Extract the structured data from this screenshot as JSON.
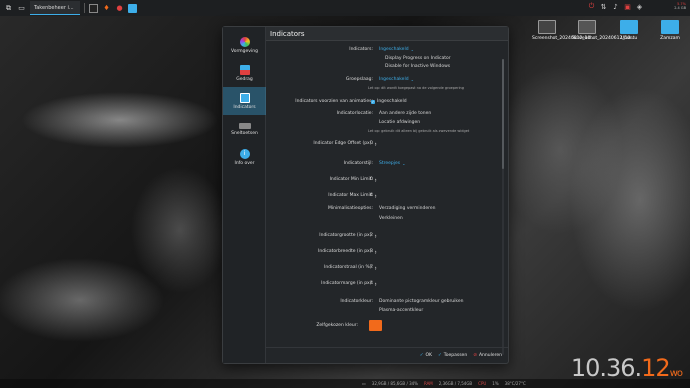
{
  "panel": {
    "task_label": "Takenbeheer i...",
    "memory": "5.7%",
    "disk": "2.4 GB"
  },
  "desktop": {
    "icons": [
      {
        "label": "Screenshot_20240612_10...",
        "color": "#555"
      },
      {
        "label": "Screenshot_20240612_10...",
        "color": "#666"
      },
      {
        "label": "Ubuntu",
        "color": "#3daee9"
      },
      {
        "label": "Zamzam",
        "color": "#3daee9"
      }
    ]
  },
  "window": {
    "title": "Indicators",
    "sidebar": [
      {
        "label": "Vormgeving",
        "icon": "palette-icon",
        "color": "#e04040"
      },
      {
        "label": "Gedrag",
        "icon": "behavior-icon",
        "color": "#3daee9"
      },
      {
        "label": "Indicators",
        "icon": "indicators-icon",
        "color": "#3daee9"
      },
      {
        "label": "Sneltoetsen",
        "icon": "keyboard-icon",
        "color": "#aaa"
      },
      {
        "label": "Info over",
        "icon": "info-icon",
        "color": "#3daee9"
      }
    ],
    "indicators_label": "Indicators:",
    "indicators_value": "Ingeschakeld",
    "display_progress": "Display Progress on Indicator",
    "disable_inactive": "Disable for Inactive Windows",
    "grouping_label": "Groepslaag:",
    "grouping_value": "Ingeschakeld",
    "grouping_hint": "Let op: dit wordt toegepast na de volgende groepering",
    "anim_label": "Indicators voorzien van animaties:",
    "anim_value": "Ingeschakeld",
    "location_label": "Indicatorlocatie:",
    "location_opt1": "Aan andere zijde tonen",
    "location_opt2": "Locatie afdwingen",
    "location_hint": "Let op: gebruik dit alleen bij gebruik als zwevende widget",
    "edge_label": "Indicator Edge Offset (px):",
    "edge_value": "0",
    "style_label": "Indicatorstijl:",
    "style_value": "Streepjes",
    "min_label": "Indicator Min Limit:",
    "min_value": "0",
    "max_label": "Indicator Max Limit:",
    "max_value": "4",
    "minimize_label": "Minimalisatieopties:",
    "minimize_opt1": "Verzadiging verminderen",
    "minimize_opt2": "Verkleinen",
    "size_label": "Indicatorgrootte (in px):",
    "size_value": "2",
    "width_label": "Indicatorbreedte (in px):",
    "width_value": "8",
    "radius_label": "Indicatorstraal (in %):",
    "radius_value": "7",
    "margin_label": "Indicatormarge (in px):",
    "margin_value": "4",
    "color_label": "Indicatorkleur:",
    "color_opt1": "Dominante pictogramkleur gebruiken",
    "color_opt2": "Plasma-accentkleur",
    "custom_color_label": "Zelfgekozen kleur:",
    "custom_color": "#f26a1b",
    "ok": "OK",
    "apply": "Toepassen",
    "cancel": "Annuleren"
  },
  "bottom": {
    "memory": "32,9GB / 85,6GB / 34%",
    "ram_label": "RAM",
    "ram": "2,36GB / 7,54GB",
    "cpu_label": "CPU",
    "cpu": "1%",
    "temp": "38°C/27°C",
    "clock_hm": "10.36.",
    "clock_s": "12",
    "clock_day": "wo"
  }
}
